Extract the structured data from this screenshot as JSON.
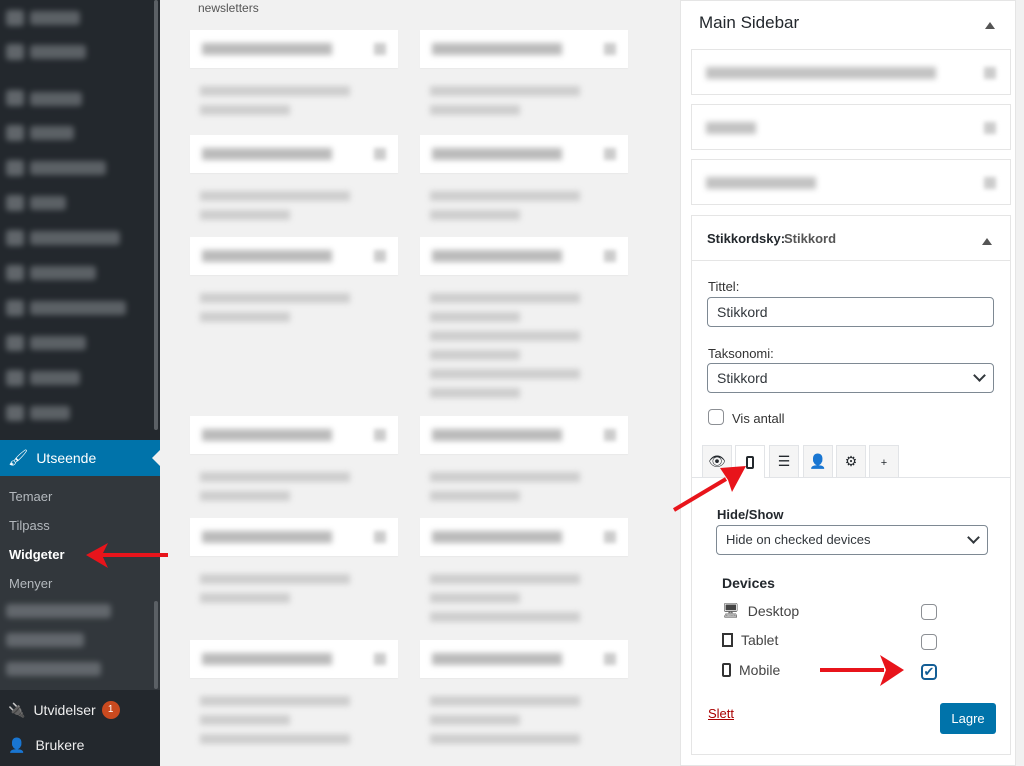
{
  "admin_menu": {
    "active": {
      "label": "Utseende",
      "icon": "paintbrush-icon"
    },
    "submenu": [
      "Temaer",
      "Tilpass",
      "Widgeter",
      "Menyer"
    ],
    "current_submenu": "Widgeter",
    "plugins": {
      "label": "Utvidelser",
      "badge": "1",
      "icon": "plugin-icon"
    },
    "users": {
      "label": "Brukere",
      "icon": "user-icon"
    }
  },
  "available_widgets": {
    "visible_text": "newsletters"
  },
  "sidebar": {
    "title": "Main Sidebar",
    "widget": {
      "header_type": "Stikkordsky:",
      "header_title": "Stikkord",
      "title_label": "Tittel:",
      "title_value": "Stikkord",
      "taxonomy_label": "Taksonomi:",
      "taxonomy_value": "Stikkord",
      "show_count_label": "Vis antall",
      "tabs": [
        "eye-icon",
        "mobile-icon",
        "align-icon",
        "user-icon",
        "gear-icon",
        "plus-icon"
      ],
      "active_tab": "mobile-icon",
      "plus": "+",
      "hide_show_label": "Hide/Show",
      "hide_show_value": "Hide on checked devices",
      "devices_label": "Devices",
      "devices": [
        {
          "label": "Desktop",
          "checked": false,
          "icon": "desktop-icon"
        },
        {
          "label": "Tablet",
          "checked": false,
          "icon": "tablet-icon"
        },
        {
          "label": "Mobile",
          "checked": true,
          "icon": "mobile-icon"
        }
      ],
      "delete_label": "Slett",
      "save_label": "Lagre"
    }
  },
  "colors": {
    "accent": "#0073aa",
    "annotation": "#e8141b",
    "menu_bg": "#23282d"
  }
}
